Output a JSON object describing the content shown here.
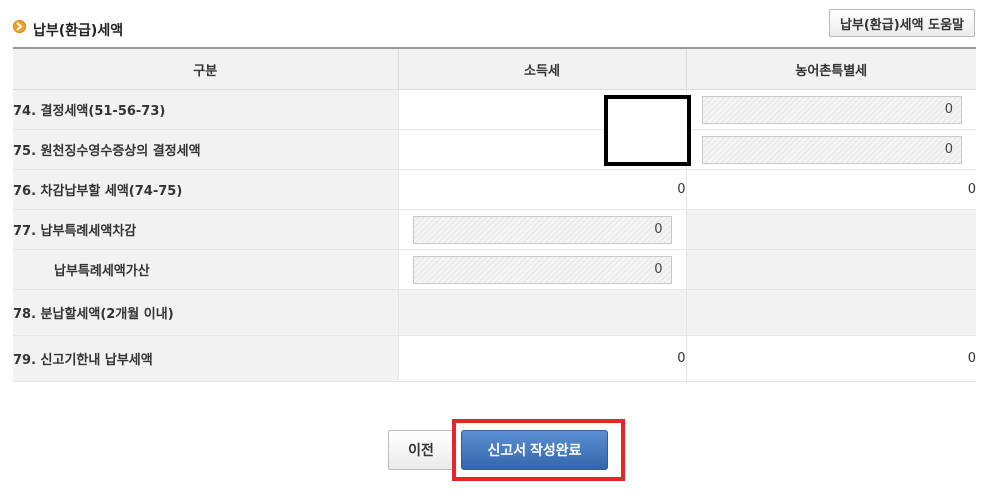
{
  "section": {
    "title": "납부(환급)세액",
    "help_button": "납부(환급)세액 도움말"
  },
  "table": {
    "headers": [
      "구분",
      "소득세",
      "농어촌특별세"
    ],
    "rows": [
      {
        "label": "74. 결정세액(51-56-73)",
        "income_tax": "",
        "rural_tax": "0"
      },
      {
        "label": "75. 원천징수영수증상의 결정세액",
        "income_tax": "",
        "rural_tax": "0"
      },
      {
        "label": "76. 차감납부할 세액(74-75)",
        "income_tax": "0",
        "rural_tax": "0"
      },
      {
        "label": "77. 납부특례세액차감",
        "income_tax": "0",
        "rural_tax": ""
      },
      {
        "label": "납부특례세액가산",
        "income_tax": "0",
        "rural_tax": ""
      },
      {
        "label": "78. 분납할세액(2개월 이내)",
        "income_tax": "",
        "rural_tax": ""
      },
      {
        "label": "79. 신고기한내 납부세액",
        "income_tax": "0",
        "rural_tax": "0"
      }
    ]
  },
  "buttons": {
    "prev": "이전",
    "complete": "신고서 작성완료"
  },
  "colors": {
    "complete_button": "#3a6db3",
    "highlight_box": "#e8252b",
    "bullet": "#f0a030"
  }
}
